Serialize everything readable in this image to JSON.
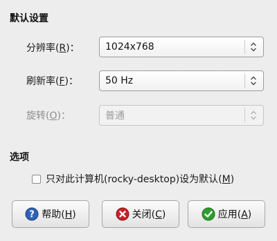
{
  "sections": {
    "default_settings": "默认设置",
    "options": "选项"
  },
  "rows": [
    {
      "label": "分辨率",
      "mnemonic": "R",
      "suffix": "：",
      "value": "1024x768",
      "enabled": true
    },
    {
      "label": "刷新率",
      "mnemonic": "F",
      "suffix": "：",
      "value": "50 Hz",
      "enabled": true
    },
    {
      "label": "旋转",
      "mnemonic": "O",
      "suffix": "：",
      "value": "普通",
      "enabled": false
    }
  ],
  "checkbox": {
    "text": "只对此计算机(rocky-desktop)设为默认",
    "mnemonic": "M",
    "checked": false
  },
  "buttons": {
    "help": {
      "label": "帮助",
      "mnemonic": "H",
      "icon": "help-icon",
      "color": "#2f62b7"
    },
    "close": {
      "label": "关闭",
      "mnemonic": "C",
      "icon": "close-icon",
      "color": "#c8202a"
    },
    "apply": {
      "label": "应用",
      "mnemonic": "A",
      "icon": "apply-icon",
      "color": "#2e9e2e"
    }
  }
}
